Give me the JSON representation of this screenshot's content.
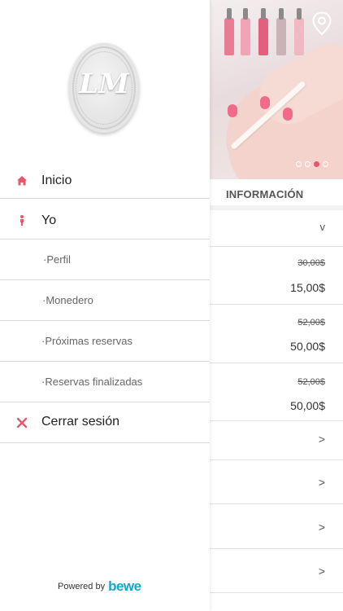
{
  "background": {
    "info_title": "INFORMACIÓN",
    "expand_symbol": "v",
    "carousel": {
      "dots": 4,
      "active_index": 2
    },
    "services": [
      {
        "old_price": "30,00$",
        "price": "15,00$"
      },
      {
        "old_price": "52,00$",
        "price": "50,00$"
      },
      {
        "old_price": "52,00$",
        "price": "50,00$"
      }
    ],
    "link_rows": [
      ">",
      ">",
      ">",
      ">"
    ]
  },
  "drawer": {
    "logo_text": "LM",
    "items": [
      {
        "label": "Inicio",
        "icon": "home-icon"
      },
      {
        "label": "Yo",
        "icon": "person-icon"
      },
      {
        "label": "·Perfil"
      },
      {
        "label": "·Monedero"
      },
      {
        "label": "·Próximas reservas"
      },
      {
        "label": "·Reservas finalizadas"
      },
      {
        "label": "Cerrar sesión",
        "icon": "close-icon"
      }
    ],
    "powered_by": "Powered by",
    "brand": "bewe"
  },
  "colors": {
    "accent": "#e8566c",
    "brand": "#14a7c6"
  }
}
